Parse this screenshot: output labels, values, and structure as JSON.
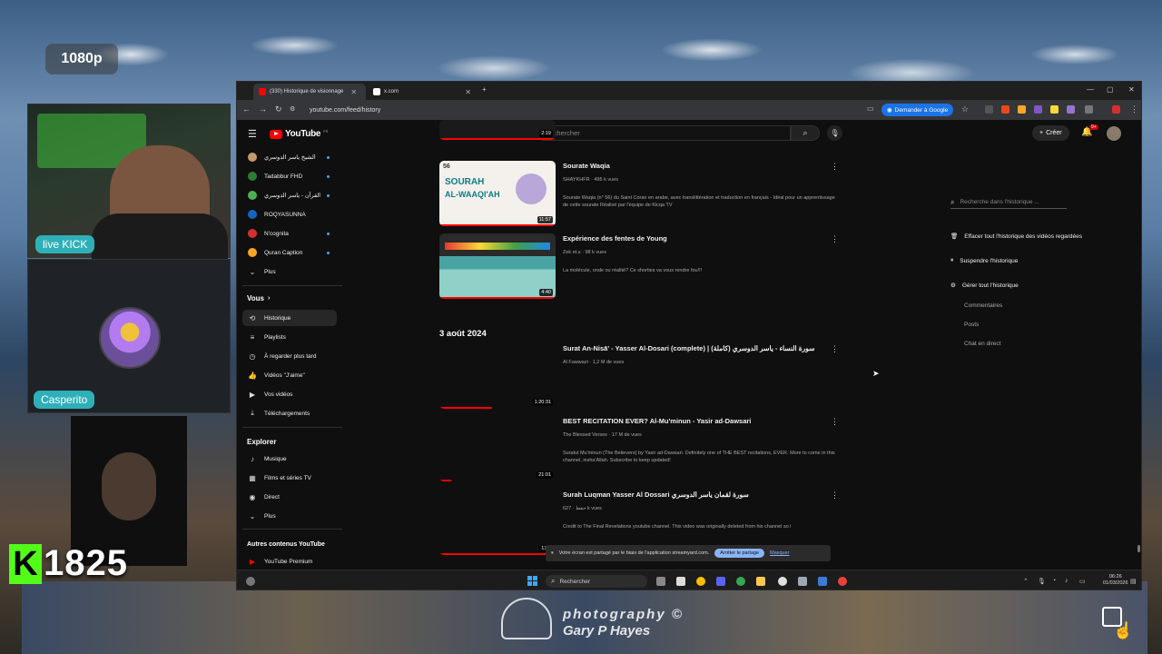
{
  "stream": {
    "resolution": "1080p",
    "cam_label_1": "live KICK",
    "cam_label_2": "Casperito",
    "viewer_count": "1825",
    "watermark_line1": "photography ©",
    "watermark_line2": "Gary P Hayes"
  },
  "browser": {
    "tabs": [
      {
        "label": "(330) Historique de visionnage",
        "favicon_color": "#ff0000"
      },
      {
        "label": "x.com",
        "favicon_color": "#ffffff"
      }
    ],
    "url": "youtube.com/feed/history",
    "ask_google_label": "Demander à Google"
  },
  "youtube": {
    "logo_text": "YouTube",
    "logo_superscript": "FR",
    "search_placeholder": "Rechercher",
    "create_label": "Créer",
    "notification_badge": "9+",
    "subscriptions": [
      {
        "label": "الشيخ ياسر الدوسري",
        "color": "#c49a6c"
      },
      {
        "label": "Tadabbur FHD",
        "color": "#2e7d32"
      },
      {
        "label": "القرآن - ياسر الدوسري",
        "color": "#4caf50"
      },
      {
        "label": "ROQYASUNNA",
        "color": "#1565c0"
      },
      {
        "label": "N'cognita",
        "color": "#d32f2f"
      },
      {
        "label": "Quran Caption",
        "color": "#f9a825"
      }
    ],
    "sidebar_more": "Plus",
    "you_heading": "Vous",
    "you_items": [
      {
        "label": "Historique",
        "icon": "history-icon",
        "glyph": "⟲"
      },
      {
        "label": "Playlists",
        "icon": "playlists-icon",
        "glyph": "≡"
      },
      {
        "label": "À regarder plus tard",
        "icon": "clock-icon",
        "glyph": "◷"
      },
      {
        "label": "Vidéos \"J'aime\"",
        "icon": "thumb-up-icon",
        "glyph": "👍"
      },
      {
        "label": "Vos vidéos",
        "icon": "video-icon",
        "glyph": "▶"
      },
      {
        "label": "Téléchargements",
        "icon": "download-icon",
        "glyph": "⤓"
      }
    ],
    "explore_heading": "Explorer",
    "explore_items": [
      {
        "label": "Musique",
        "icon": "music-icon",
        "glyph": "♪"
      },
      {
        "label": "Films et séries TV",
        "icon": "film-icon",
        "glyph": "▦"
      },
      {
        "label": "Direct",
        "icon": "live-icon",
        "glyph": "◉"
      },
      {
        "label": "Plus",
        "icon": "chevron-down-icon",
        "glyph": "⌄"
      }
    ],
    "other_heading": "Autres contenus YouTube",
    "other_items": [
      {
        "label": "YouTube Premium",
        "icon": "youtube-premium-icon"
      }
    ],
    "videos_top": [
      {
        "title": "Sourate Waqia",
        "meta": "SHAYKHFR · 495 k vues",
        "desc": "Sourate Waqia (n° 56) du Saint Coran en arabe, avec translittération et traduction en français - Idéal pour un apprentissage de cette sourate Réalisé par l'équipe de Kicqa TV",
        "duration": "11:57",
        "thumb_text_1": "SOURAH",
        "thumb_text_2": "AL-WAAQI'AH",
        "thumb_badge": "56",
        "progress": 1.0
      },
      {
        "title": "Expérience des fentes de Young",
        "meta": "Zek et.s · 98 k vues",
        "desc": "La molécule, onde ou réalité? Ce shorties va vous rendre fou!!!",
        "duration": "4:40",
        "progress": 1.0
      }
    ],
    "partial_duration": "2:19",
    "date_heading": "3 août 2024",
    "videos_date": [
      {
        "title": "Surat An-Nisā' - Yasser Al-Dosari (complete) | (كاملة) سورة النساء - ياسر الدوسري",
        "meta": "Al Fawwazi · 1,2 M de vues",
        "desc": "",
        "duration": "1:20:31",
        "progress": 0.45
      },
      {
        "title": "BEST RECITATION EVER? Al-Mu'minun - Yasir ad-Dawsari",
        "meta": "The Blessed Verses · 17 M de vues",
        "desc": "Suratul Mu'minun (The Believers) by Yasir ad-Dawsari. Definitely one of THE BEST recitations, EVER. More to come in this channel, insha'Allah. Subscribe to keep updated!",
        "duration": "21:01",
        "progress": 0.1
      },
      {
        "title": "Surah Luqman Yasser Al Dossari سورة لقمان ياسر الدوسري",
        "meta": "حفظ · 627 k vues",
        "desc": "Credit to The Final Revelations youtube channel. This video was originally deleted from his channel so i",
        "duration": "13:4",
        "progress": 0.95
      }
    ],
    "history_panel": {
      "search_placeholder": "Recherche dans l'historique ...",
      "actions": [
        {
          "label": "Effacer tout l'historique des vidéos regardées",
          "icon": "trash-icon",
          "glyph": "🗑"
        },
        {
          "label": "Suspendre l'historique",
          "icon": "pause-icon",
          "glyph": "⏸"
        },
        {
          "label": "Gérer tout l'historique",
          "icon": "gear-icon",
          "glyph": "⚙"
        }
      ],
      "sub_items": [
        "Commentaires",
        "Posts",
        "Chat en direct"
      ]
    }
  },
  "share_banner": {
    "text": "Votre écran est partagé par le biais de l'application streamyard.com.",
    "stop_label": "Arrêter le partage",
    "hide_label": "Masquer"
  },
  "taskbar": {
    "search_placeholder": "Rechercher",
    "time": "06:26",
    "date": "01/03/2026"
  }
}
